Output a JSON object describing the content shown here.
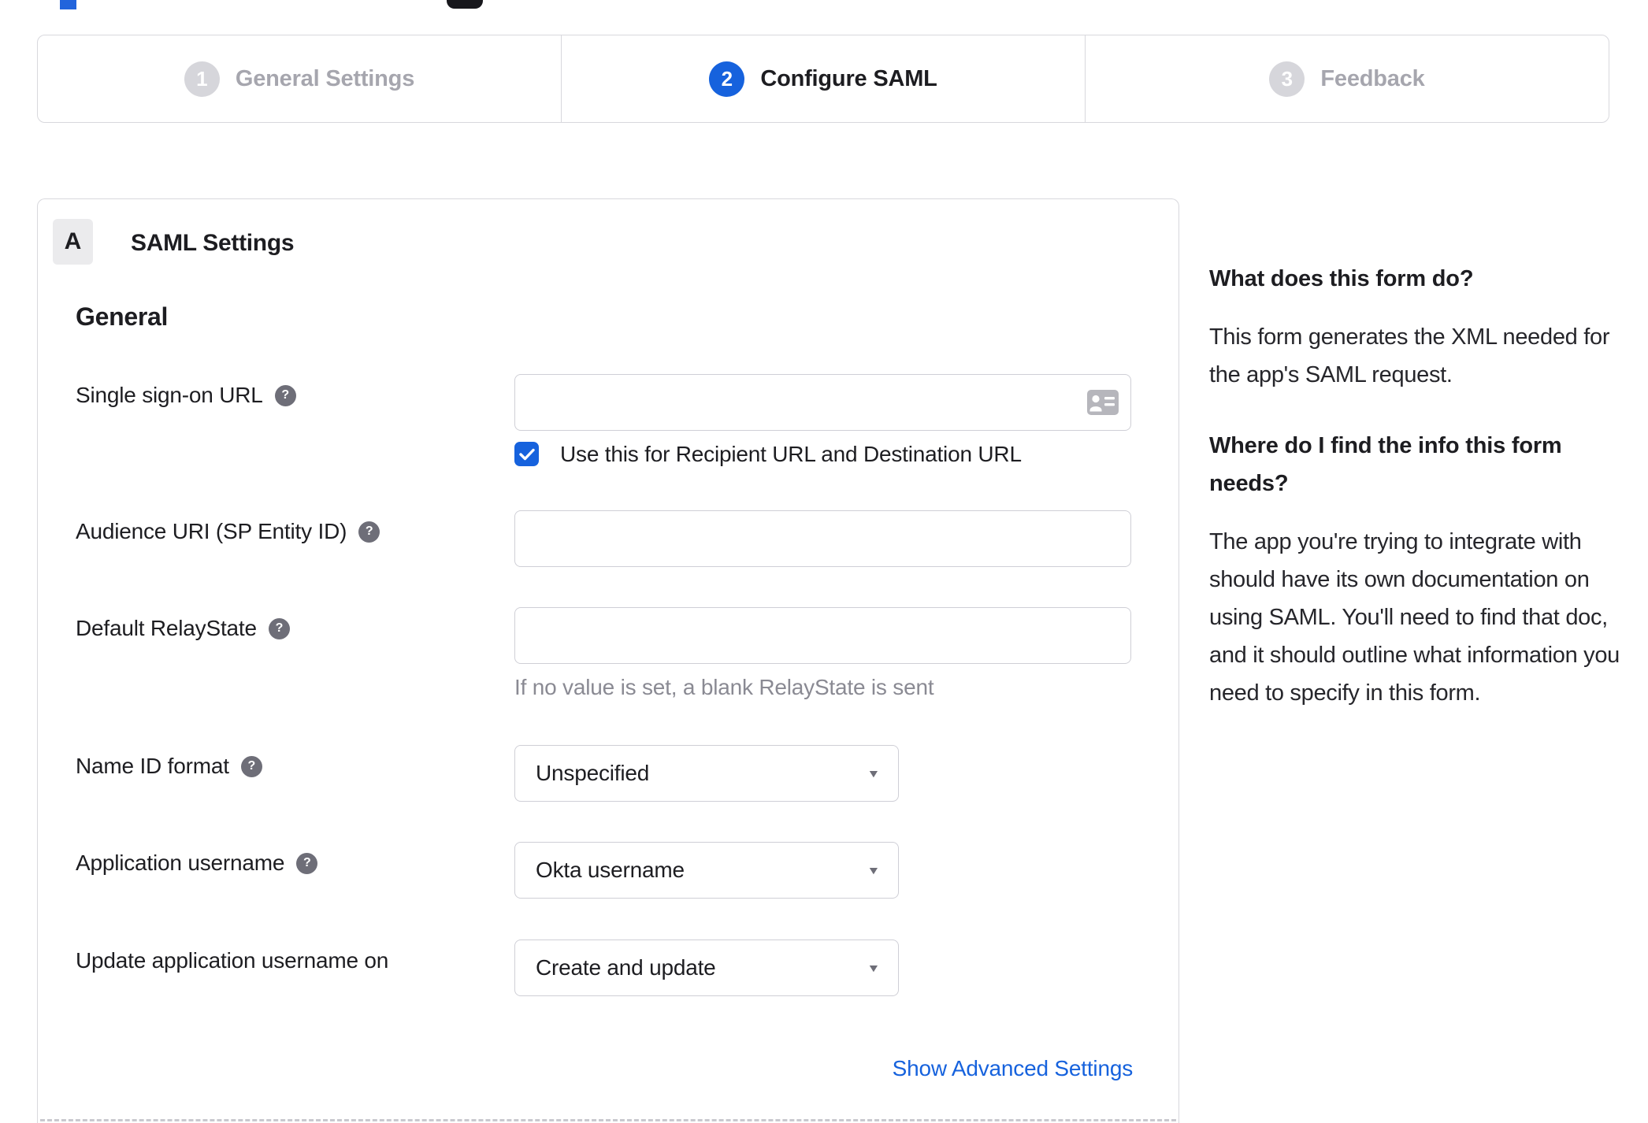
{
  "stepper": {
    "steps": [
      {
        "number": "1",
        "label": "General Settings",
        "state": "inactive"
      },
      {
        "number": "2",
        "label": "Configure SAML",
        "state": "active"
      },
      {
        "number": "3",
        "label": "Feedback",
        "state": "inactive"
      }
    ]
  },
  "panel": {
    "section_badge": "A",
    "section_title": "SAML Settings",
    "group_title": "General",
    "fields": {
      "sso_url": {
        "label": "Single sign-on URL",
        "value": "",
        "checkbox_label": "Use this for Recipient URL and Destination URL",
        "checkbox_checked": true
      },
      "audience_uri": {
        "label": "Audience URI (SP Entity ID)",
        "value": ""
      },
      "default_relaystate": {
        "label": "Default RelayState",
        "value": "",
        "hint": "If no value is set, a blank RelayState is sent"
      },
      "name_id_format": {
        "label": "Name ID format",
        "value": "Unspecified"
      },
      "app_username": {
        "label": "Application username",
        "value": "Okta username"
      },
      "update_app_username": {
        "label": "Update application username on",
        "value": "Create and update"
      }
    },
    "advanced_link": "Show Advanced Settings"
  },
  "help": {
    "q1": "What does this form do?",
    "a1": "This form generates the XML needed for the app's SAML request.",
    "q2": "Where do I find the info this form needs?",
    "a2": "The app you're trying to integrate with should have its own documentation on using SAML. You'll need to find that doc, and it should outline what information you need to specify in this form."
  },
  "icons": {
    "question_mark": "?",
    "dropdown_caret": "▼"
  },
  "colors": {
    "accent_blue": "#1662dd",
    "text_dark": "#1d1d21",
    "inactive_gray": "#a6a6ae",
    "border_gray": "#d8d8dd",
    "hint_gray": "#8a8a93"
  }
}
